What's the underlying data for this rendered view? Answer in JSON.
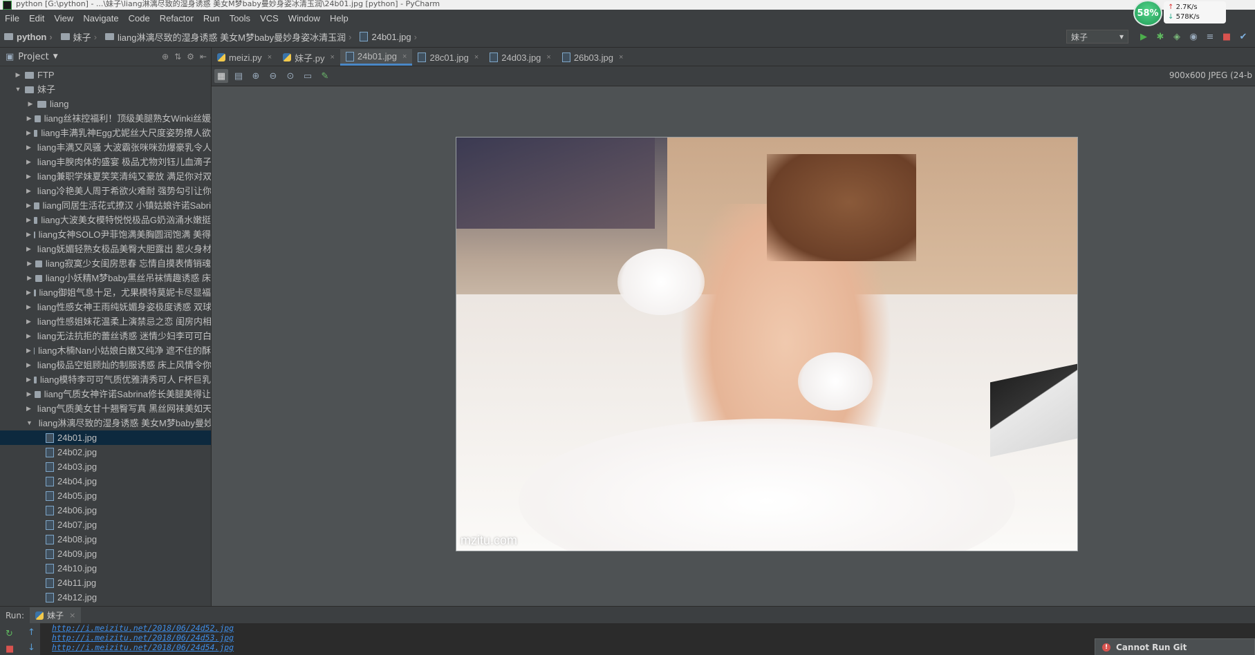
{
  "window": {
    "title": "python [G:\\python] - ...\\妹子\\liang淋漓尽致的湿身诱惑 美女M梦baby曼妙身姿冰清玉润\\24b01.jpg [python] - PyCharm"
  },
  "menu": [
    "File",
    "Edit",
    "View",
    "Navigate",
    "Code",
    "Refactor",
    "Run",
    "Tools",
    "VCS",
    "Window",
    "Help"
  ],
  "breadcrumbs": [
    "python",
    "妹子",
    "liang淋漓尽致的湿身诱惑 美女M梦baby曼妙身姿冰清玉润",
    "24b01.jpg"
  ],
  "run_config": "妹子",
  "system_widget": {
    "cpu": "58%",
    "up": "2.7K/s",
    "down": "578K/s"
  },
  "project_panel": {
    "title": "Project"
  },
  "tree": [
    {
      "label": "FTP",
      "level": 1,
      "state": "collapsed",
      "kind": "folder"
    },
    {
      "label": "妹子",
      "level": 1,
      "state": "expanded",
      "kind": "folder"
    },
    {
      "label": "liang",
      "level": 2,
      "state": "collapsed",
      "kind": "folder"
    },
    {
      "label": "liang丝袜控福利！顶级美腿熟女Winki丝媛",
      "level": 2,
      "state": "collapsed",
      "kind": "folder"
    },
    {
      "label": "liang丰满乳神Egg尤妮丝大尺度姿势撩人欲",
      "level": 2,
      "state": "collapsed",
      "kind": "folder"
    },
    {
      "label": "liang丰满又风骚 大波霸张咪咪劲爆豪乳令人",
      "level": 2,
      "state": "collapsed",
      "kind": "folder"
    },
    {
      "label": "liang丰腴肉体的盛宴 极品尤物刘钰儿血滴子",
      "level": 2,
      "state": "collapsed",
      "kind": "folder"
    },
    {
      "label": "liang兼职学妹夏笑笑清纯又豪放 满足你对双",
      "level": 2,
      "state": "collapsed",
      "kind": "folder"
    },
    {
      "label": "liang冷艳美人周于希欲火难耐 强势勾引让你",
      "level": 2,
      "state": "collapsed",
      "kind": "folder"
    },
    {
      "label": "liang同居生活花式撩汉 小镇姑娘许诺Sabri",
      "level": 2,
      "state": "collapsed",
      "kind": "folder"
    },
    {
      "label": "liang大波美女模特悦悦极品G奶汹涌水嫩挺",
      "level": 2,
      "state": "collapsed",
      "kind": "folder"
    },
    {
      "label": "liang女神SOLO尹菲饱满美胸圆润饱满 美得",
      "level": 2,
      "state": "collapsed",
      "kind": "folder"
    },
    {
      "label": "liang妩媚轻熟女极品美臀大胆露出 惹火身材",
      "level": 2,
      "state": "collapsed",
      "kind": "folder"
    },
    {
      "label": "liang寂寞少女闺房思春 忘情自摸表情销魂",
      "level": 2,
      "state": "collapsed",
      "kind": "folder"
    },
    {
      "label": "liang小妖精M梦baby黑丝吊袜情趣诱惑 床",
      "level": 2,
      "state": "collapsed",
      "kind": "folder"
    },
    {
      "label": "liang御姐气息十足，尤果模特莫妮卡尽显福",
      "level": 2,
      "state": "collapsed",
      "kind": "folder"
    },
    {
      "label": "liang性感女神王雨纯妩媚身姿极度诱惑 双球",
      "level": 2,
      "state": "collapsed",
      "kind": "folder"
    },
    {
      "label": "liang性感姐妹花温柔上演禁忌之恋 闺房内相",
      "level": 2,
      "state": "collapsed",
      "kind": "folder"
    },
    {
      "label": "liang无法抗拒的蕾丝诱惑 迷情少妇李可可白",
      "level": 2,
      "state": "collapsed",
      "kind": "folder"
    },
    {
      "label": "liang木楠Nan小姑娘白嫩又纯净 遮不住的酥",
      "level": 2,
      "state": "collapsed",
      "kind": "folder"
    },
    {
      "label": "liang极品空姐顾灿的制服诱惑 床上风情令你",
      "level": 2,
      "state": "collapsed",
      "kind": "folder"
    },
    {
      "label": "liang模特李可可气质优雅清秀可人 F杯巨乳",
      "level": 2,
      "state": "collapsed",
      "kind": "folder"
    },
    {
      "label": "liang气质女神许诺Sabrina修长美腿美得让",
      "level": 2,
      "state": "collapsed",
      "kind": "folder"
    },
    {
      "label": "liang气质美女甘十翘臀写真 黑丝网袜美如天",
      "level": 2,
      "state": "collapsed",
      "kind": "folder"
    },
    {
      "label": "liang淋漓尽致的湿身诱惑 美女M梦baby曼妙",
      "level": 2,
      "state": "expanded",
      "kind": "folder"
    },
    {
      "label": "24b01.jpg",
      "level": 3,
      "state": "selected",
      "kind": "file"
    },
    {
      "label": "24b02.jpg",
      "level": 3,
      "state": "",
      "kind": "file"
    },
    {
      "label": "24b03.jpg",
      "level": 3,
      "state": "",
      "kind": "file"
    },
    {
      "label": "24b04.jpg",
      "level": 3,
      "state": "",
      "kind": "file"
    },
    {
      "label": "24b05.jpg",
      "level": 3,
      "state": "",
      "kind": "file"
    },
    {
      "label": "24b06.jpg",
      "level": 3,
      "state": "",
      "kind": "file"
    },
    {
      "label": "24b07.jpg",
      "level": 3,
      "state": "",
      "kind": "file"
    },
    {
      "label": "24b08.jpg",
      "level": 3,
      "state": "",
      "kind": "file"
    },
    {
      "label": "24b09.jpg",
      "level": 3,
      "state": "",
      "kind": "file"
    },
    {
      "label": "24b10.jpg",
      "level": 3,
      "state": "",
      "kind": "file"
    },
    {
      "label": "24b11.jpg",
      "level": 3,
      "state": "",
      "kind": "file"
    },
    {
      "label": "24b12.jpg",
      "level": 3,
      "state": "",
      "kind": "file"
    }
  ],
  "tabs": [
    {
      "label": "meizi.py",
      "type": "py",
      "active": false
    },
    {
      "label": "妹子.py",
      "type": "py",
      "active": false
    },
    {
      "label": "24b01.jpg",
      "type": "img",
      "active": true
    },
    {
      "label": "28c01.jpg",
      "type": "img",
      "active": false
    },
    {
      "label": "24d03.jpg",
      "type": "img",
      "active": false
    },
    {
      "label": "26b03.jpg",
      "type": "img",
      "active": false
    }
  ],
  "image_info": "900x600 JPEG (24-b",
  "image_watermark": "mzitu.com",
  "run_panel": {
    "label": "Run:",
    "tab": "妹子"
  },
  "console_lines": [
    "http://i.meizitu.net/2018/06/24d52.jpg",
    "http://i.meizitu.net/2018/06/24d53.jpg",
    "http://i.meizitu.net/2018/06/24d54.jpg"
  ],
  "notification": "Cannot Run Git",
  "colors": {
    "accent": "#4a88c7",
    "selection": "#0d293e",
    "link": "#3f8ee8"
  }
}
